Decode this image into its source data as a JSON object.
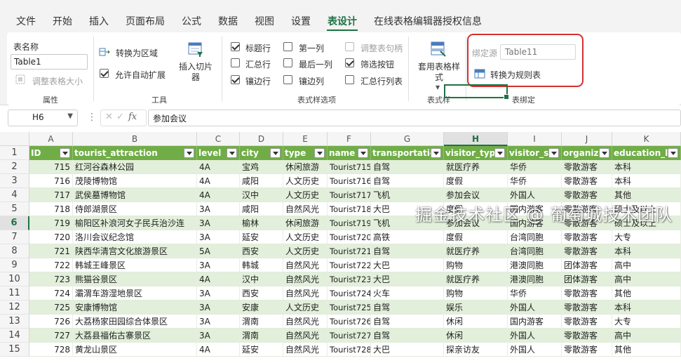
{
  "menu": {
    "tabs": [
      "文件",
      "开始",
      "插入",
      "页面布局",
      "公式",
      "数据",
      "视图",
      "设置",
      "表设计",
      "在线表格编辑器授权信息"
    ],
    "active": "表设计"
  },
  "ribbon": {
    "properties": {
      "table_name_label": "表名称",
      "table_name_value": "Table1",
      "resize_label": "调整表格大小",
      "group": "属性"
    },
    "tools": {
      "convert_range": "转换为区域",
      "auto_expand": "允许自动扩展",
      "auto_expand_checked": true,
      "insert_slicer": "插入切片器",
      "group": "工具"
    },
    "style_options": {
      "group": "表式样选项",
      "items": [
        {
          "label": "标题行",
          "checked": true,
          "disabled": false
        },
        {
          "label": "第一列",
          "checked": false,
          "disabled": false
        },
        {
          "label": "调整表句柄",
          "checked": false,
          "disabled": true
        },
        {
          "label": "汇总行",
          "checked": false,
          "disabled": false
        },
        {
          "label": "最后一列",
          "checked": false,
          "disabled": false
        },
        {
          "label": "筛选按钮",
          "checked": true,
          "disabled": false
        },
        {
          "label": "镶边行",
          "checked": true,
          "disabled": false
        },
        {
          "label": "镶边列",
          "checked": false,
          "disabled": false
        },
        {
          "label": "汇总行列表",
          "checked": false,
          "disabled": false
        }
      ]
    },
    "table_styles": {
      "button": "套用表格样式",
      "group": "表式样"
    },
    "binding": {
      "source_label": "绑定源",
      "source_placeholder": "Table11",
      "convert": "转换为规则表",
      "group": "表绑定"
    }
  },
  "formula_bar": {
    "name_box": "H6",
    "fx": "fx",
    "formula": "参加会议"
  },
  "grid": {
    "columns": [
      "A",
      "B",
      "C",
      "D",
      "E",
      "F",
      "G",
      "H",
      "I",
      "J",
      "K"
    ],
    "selected_column": "H",
    "selected_row": "6",
    "rows_numbers": [
      "1",
      "2",
      "3",
      "4",
      "5",
      "6",
      "7",
      "8",
      "9",
      "10",
      "11",
      "12",
      "13",
      "14",
      "15"
    ],
    "headers": [
      "ID",
      "tourist_attraction",
      "level",
      "city",
      "type",
      "name",
      "transportation",
      "visitor_type",
      "visitor_sta",
      "organizat",
      "education_l"
    ],
    "rows": [
      [
        "715",
        "红河谷森林公园",
        "4A",
        "宝鸡",
        "休闲旅游",
        "Tourist715",
        "自驾",
        "就医疗养",
        "华侨",
        "零散游客",
        "本科"
      ],
      [
        "716",
        "茂陵博物馆",
        "4A",
        "咸阳",
        "人文历史",
        "Tourist716",
        "自驾",
        "度假",
        "华侨",
        "零散游客",
        "本科"
      ],
      [
        "717",
        "武侯墓博物馆",
        "4A",
        "汉中",
        "人文历史",
        "Tourist717",
        "飞机",
        "参加会议",
        "外国人",
        "零散游客",
        "其他"
      ],
      [
        "718",
        "侍郎湖景区",
        "3A",
        "咸阳",
        "自然风光",
        "Tourist718",
        "大巴",
        "度假",
        "国内游客",
        "零散游客",
        "硕士及以上"
      ],
      [
        "719",
        "榆阳区补浪河女子民兵治沙连",
        "3A",
        "榆林",
        "休闲旅游",
        "Tourist719",
        "飞机",
        "参加会议",
        "国内游客",
        "零散游客",
        "硕士及以上"
      ],
      [
        "720",
        "洛川会议纪念馆",
        "3A",
        "延安",
        "人文历史",
        "Tourist720",
        "高铁",
        "度假",
        "台湾同胞",
        "零散游客",
        "大专"
      ],
      [
        "721",
        "陕西华清宫文化旅游景区",
        "5A",
        "西安",
        "人文历史",
        "Tourist721",
        "自驾",
        "就医疗养",
        "台湾同胞",
        "零散游客",
        "本科"
      ],
      [
        "722",
        "韩城王峰景区",
        "3A",
        "韩城",
        "自然风光",
        "Tourist722",
        "大巴",
        "购物",
        "港澳同胞",
        "团体游客",
        "高中"
      ],
      [
        "723",
        "熊猫谷景区",
        "4A",
        "汉中",
        "自然风光",
        "Tourist723",
        "大巴",
        "就医疗养",
        "港澳同胞",
        "团体游客",
        "高中"
      ],
      [
        "724",
        "灞渭车游湿地景区",
        "3A",
        "西安",
        "自然风光",
        "Tourist724",
        "火车",
        "购物",
        "华侨",
        "零散游客",
        "其他"
      ],
      [
        "725",
        "安康博物馆",
        "3A",
        "安康",
        "人文历史",
        "Tourist725",
        "自驾",
        "娱乐",
        "外国人",
        "零散游客",
        "本科"
      ],
      [
        "726",
        "大荔杨家田园综合体景区",
        "3A",
        "渭南",
        "自然风光",
        "Tourist726",
        "自驾",
        "休闲",
        "国内游客",
        "零散游客",
        "大专"
      ],
      [
        "727",
        "大荔县福佑古寨景区",
        "3A",
        "渭南",
        "自然风光",
        "Tourist727",
        "自驾",
        "休闲",
        "外国人",
        "零散游客",
        "高中"
      ],
      [
        "728",
        "黄龙山景区",
        "4A",
        "延安",
        "自然风光",
        "Tourist728",
        "大巴",
        "探亲访友",
        "外国人",
        "零散游客",
        "其他"
      ]
    ]
  },
  "watermark": "掘金技术社区 @ 葡萄城技术团队",
  "colors": {
    "accent": "#1f7244",
    "table_header": "#70ad47",
    "band_row": "#e2efda",
    "highlight": "#d32f2f"
  }
}
